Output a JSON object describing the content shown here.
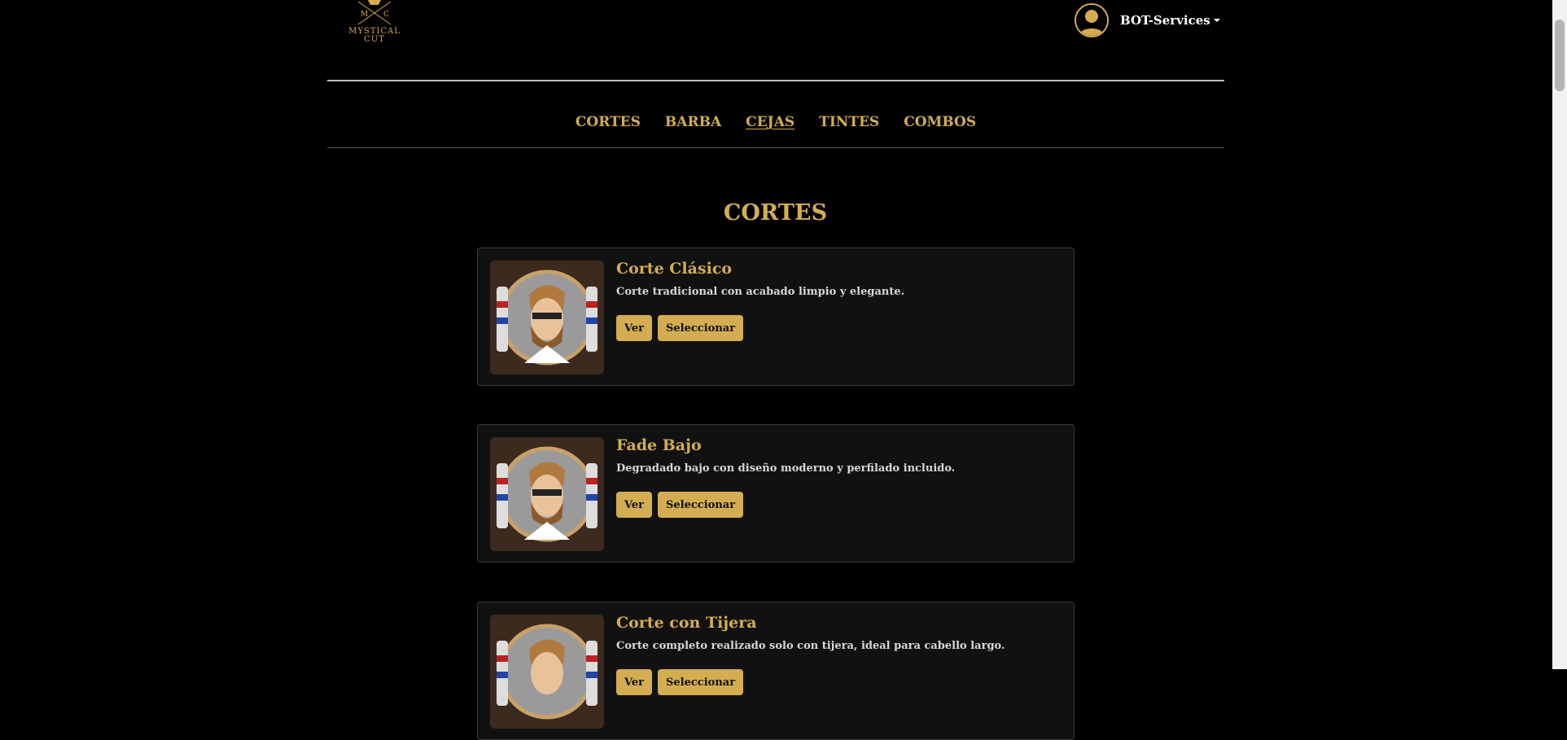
{
  "brand": {
    "letters_left": "M",
    "letters_right": "C",
    "name_line1": "MYSTICAL",
    "name_line2": "CUT"
  },
  "user": {
    "name": "BOT-Services"
  },
  "nav": {
    "items": [
      {
        "label": "CORTES",
        "active": false
      },
      {
        "label": "BARBA",
        "active": false
      },
      {
        "label": "CEJAS",
        "active": true
      },
      {
        "label": "TINTES",
        "active": false
      },
      {
        "label": "COMBOS",
        "active": false
      }
    ]
  },
  "section": {
    "title": "CORTES"
  },
  "services": [
    {
      "title": "Corte Clásico",
      "description": "Corte tradicional con acabado limpio y elegante.",
      "view_label": "Ver",
      "select_label": "Seleccionar"
    },
    {
      "title": "Fade Bajo",
      "description": "Degradado bajo con diseño moderno y perfilado incluido.",
      "view_label": "Ver",
      "select_label": "Seleccionar"
    },
    {
      "title": "Corte con Tijera",
      "description": "Corte completo realizado solo con tijera, ideal para cabello largo.",
      "view_label": "Ver",
      "select_label": "Seleccionar"
    }
  ],
  "colors": {
    "background": "#000000",
    "accent": "#d4ad52",
    "card": "#111111"
  }
}
